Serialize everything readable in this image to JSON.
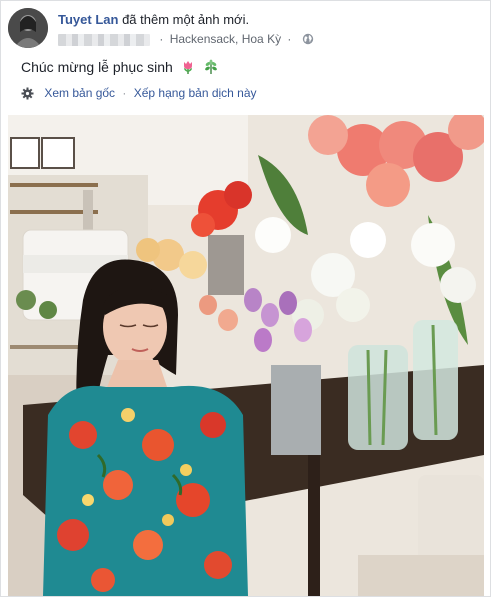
{
  "post": {
    "author": "Tuyet Lan",
    "action": "đã thêm một ảnh mới.",
    "location": "Hackensack, Hoa Kỳ",
    "text": "Chúc mừng lễ phục sinh",
    "emoji": [
      "tulip",
      "herb"
    ]
  },
  "translation": {
    "view_original": "Xem bản gốc",
    "rate_translation": "Xếp hạng bản dịch này"
  },
  "colors": {
    "link": "#365899",
    "meta": "#616770",
    "text": "#1d2129"
  },
  "icons": [
    "gear-icon",
    "globe-icon",
    "tulip-emoji",
    "herb-emoji"
  ]
}
